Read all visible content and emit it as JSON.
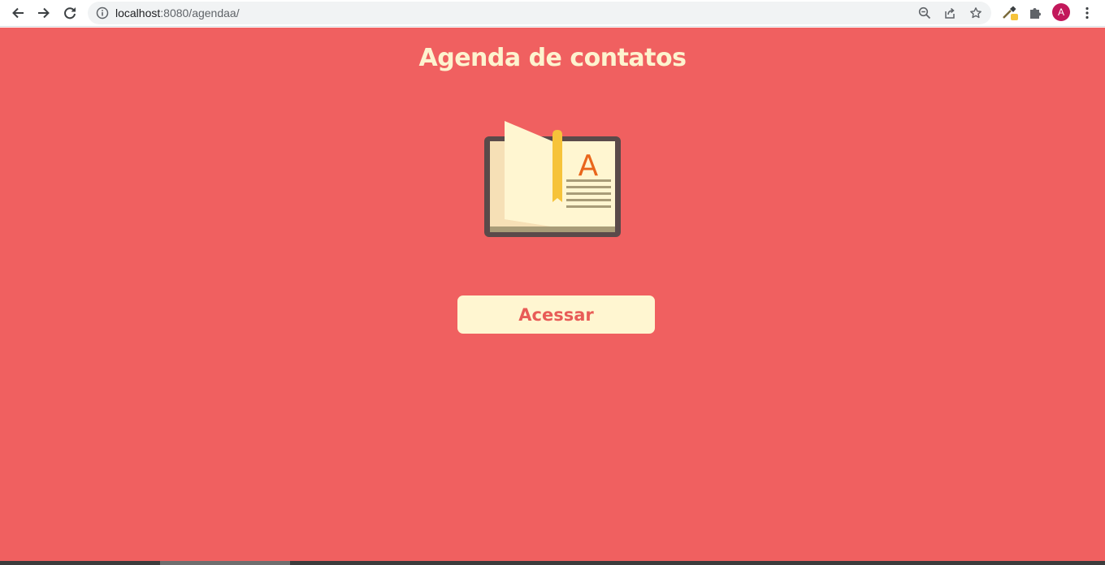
{
  "browser": {
    "url_host": "localhost",
    "url_rest": ":8080/agendaa/",
    "profile_initial": "A",
    "icons": {
      "back": "back-arrow-icon",
      "forward": "forward-arrow-icon",
      "reload": "reload-icon",
      "site_info": "info-icon",
      "zoom": "zoom-out-icon",
      "share": "share-icon",
      "bookmark": "star-icon",
      "eyedropper": "eyedropper-extension-icon",
      "extensions": "puzzle-icon",
      "menu": "kebab-menu-icon"
    }
  },
  "page": {
    "title": "Agenda de contatos",
    "book_letter": "A",
    "button_label": "Acessar"
  },
  "colors": {
    "background": "#f06060",
    "title": "#fdf3cf",
    "button_bg": "#fff6d1",
    "button_text": "#e85c57",
    "avatar": "#c2185b"
  }
}
